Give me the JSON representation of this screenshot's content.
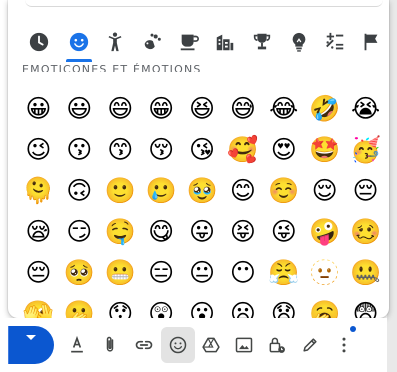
{
  "emoji_picker": {
    "section_heading": "EMOTICONES ET ÉMOTIONS",
    "categories": [
      {
        "name": "recent",
        "icon": "clock-icon"
      },
      {
        "name": "smileys",
        "icon": "smiley-icon",
        "active": true
      },
      {
        "name": "people",
        "icon": "person-icon"
      },
      {
        "name": "animals",
        "icon": "animals-icon"
      },
      {
        "name": "food",
        "icon": "cup-icon"
      },
      {
        "name": "travel",
        "icon": "buildings-icon"
      },
      {
        "name": "activities",
        "icon": "trophy-icon"
      },
      {
        "name": "objects",
        "icon": "lightbulb-icon"
      },
      {
        "name": "symbols",
        "icon": "symbols-icon"
      },
      {
        "name": "flags",
        "icon": "flag-icon"
      }
    ],
    "emojis": [
      "😀",
      "😃",
      "😄",
      "😁",
      "😆",
      "😅",
      "😂",
      "🤣",
      "😭",
      "😉",
      "😗",
      "😙",
      "😚",
      "😘",
      "🥰",
      "😍",
      "🤩",
      "🥳",
      "🫠",
      "🙃",
      "🙂",
      "🥲",
      "🥹",
      "😊",
      "☺️",
      "😌",
      "😔",
      "😪",
      "😏",
      "🤤",
      "😋",
      "😛",
      "😝",
      "😜",
      "🤪",
      "🥴",
      "😔",
      "🥺",
      "😬",
      "😑",
      "😐",
      "😶",
      "😤",
      "🫥",
      "🤐",
      "🫣",
      "🫢",
      "😯",
      "😲",
      "😮",
      "😦",
      "😧",
      "🥱",
      "😨"
    ],
    "accent_color": "#1a73e8"
  },
  "toolbar": {
    "send_color": "#0b57d0",
    "icons": [
      "text-format-icon",
      "attachment-icon",
      "link-icon",
      "emoji-icon",
      "drive-icon",
      "photo-icon",
      "lock-clock-icon",
      "pen-icon",
      "more-options-icon"
    ]
  }
}
